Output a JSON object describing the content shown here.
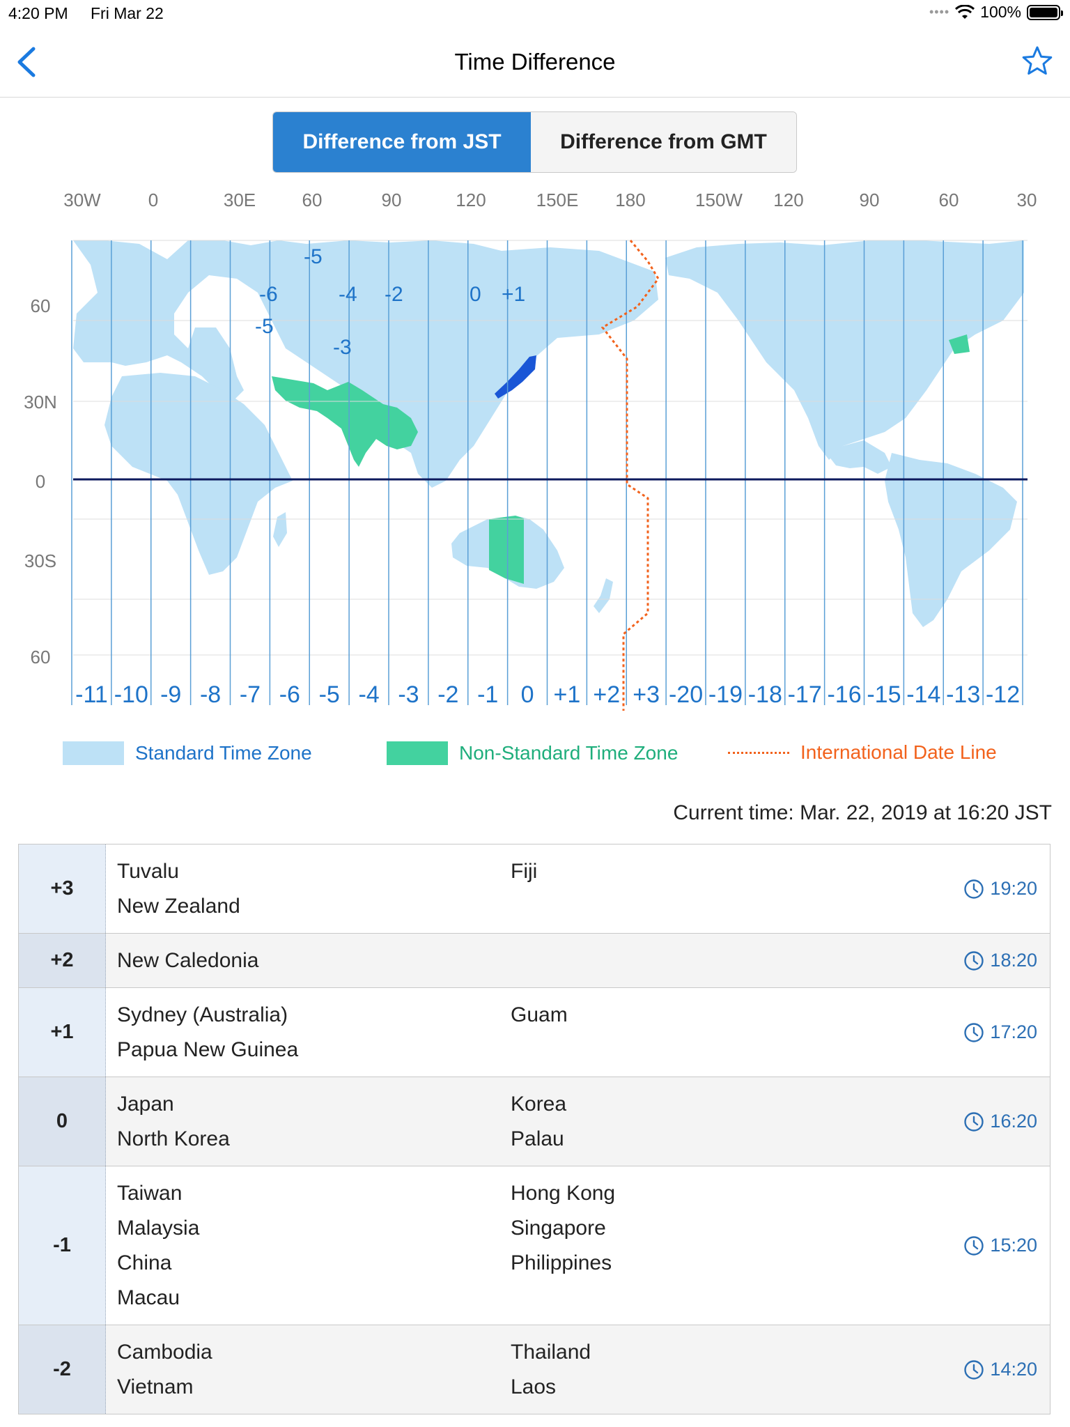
{
  "status_bar": {
    "time": "4:20 PM",
    "date": "Fri Mar 22",
    "battery": "100%",
    "signal_icon": "dots-icon",
    "wifi_icon": "wifi-icon"
  },
  "nav": {
    "title": "Time Difference",
    "back_icon": "chevron-left-icon",
    "favorite_icon": "star-icon"
  },
  "segment": {
    "options": [
      "Difference from JST",
      "Difference from GMT"
    ],
    "selected": 0
  },
  "map": {
    "top_longitudes": [
      "30W",
      "0",
      "30E",
      "60",
      "90",
      "120",
      "150E",
      "180",
      "150W",
      "120",
      "90",
      "60",
      "30"
    ],
    "left_latitudes": [
      "60",
      "30N",
      "0",
      "30S",
      "60"
    ],
    "bottom_offsets": [
      "-11",
      "-10",
      "-9",
      "-8",
      "-7",
      "-6",
      "-5",
      "-4",
      "-3",
      "-2",
      "-1",
      "0",
      "+1",
      "+2",
      "+3",
      "-20",
      "-19",
      "-18",
      "-17",
      "-16",
      "-15",
      "-14",
      "-13",
      "-12"
    ],
    "zone_labels": [
      {
        "text": "-6"
      },
      {
        "text": "-5"
      },
      {
        "text": "-4"
      },
      {
        "text": "-2"
      },
      {
        "text": "0"
      },
      {
        "text": "+1"
      },
      {
        "text": "-5"
      },
      {
        "text": "-3"
      }
    ],
    "colors": {
      "standard": "#bde1f6",
      "non_standard": "#43d29f",
      "date_line": "#f2621c",
      "zone_line": "#5a9fd6",
      "equator": "#0d1a5e",
      "label": "#1e73c8",
      "japan": "#1a56d6"
    }
  },
  "legend": {
    "standard": "Standard Time Zone",
    "non_standard": "Non-Standard Time Zone",
    "date_line": "International Date Line"
  },
  "current_time": "Current time: Mar. 22, 2019 at 16:20 JST",
  "rows": [
    {
      "offset": "+3",
      "left": [
        "Tuvalu",
        "New Zealand"
      ],
      "right": [
        "Fiji"
      ],
      "time": "19:20"
    },
    {
      "offset": "+2",
      "left": [
        "New Caledonia"
      ],
      "right": [],
      "time": "18:20"
    },
    {
      "offset": "+1",
      "left": [
        "Sydney (Australia)",
        "Papua New Guinea"
      ],
      "right": [
        "Guam"
      ],
      "time": "17:20"
    },
    {
      "offset": "0",
      "left": [
        "Japan",
        "North Korea"
      ],
      "right": [
        "Korea",
        "Palau"
      ],
      "time": "16:20"
    },
    {
      "offset": "-1",
      "left": [
        "Taiwan",
        "Malaysia",
        "China",
        "Macau"
      ],
      "right": [
        "Hong Kong",
        "Singapore",
        "Philippines"
      ],
      "time": "15:20"
    },
    {
      "offset": "-2",
      "left": [
        "Cambodia",
        "Vietnam"
      ],
      "right": [
        "Thailand",
        "Laos"
      ],
      "time": "14:20"
    }
  ]
}
